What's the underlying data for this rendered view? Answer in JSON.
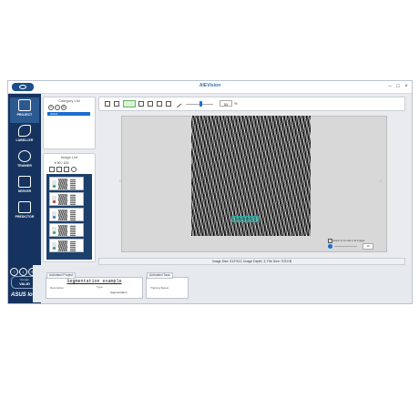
{
  "titlebar": {
    "title": "AIEVision",
    "minimize": "–",
    "maximize": "□",
    "close": "×"
  },
  "sidebar": {
    "items": [
      {
        "label": "PROJECT",
        "icon": "project-icon"
      },
      {
        "label": "LABELLER",
        "icon": "labeller-icon"
      },
      {
        "label": "TRAINER",
        "icon": "trainer-icon"
      },
      {
        "label": "SERVER",
        "icon": "server-icon"
      },
      {
        "label": "PREDICTOR",
        "icon": "predictor-icon"
      }
    ],
    "help_buttons": [
      "?",
      "i",
      "⟲"
    ],
    "license_caption": "Dongle",
    "license_status": "VALID",
    "brand": "ASUS IoT"
  },
  "category_list": {
    "title": "Category List",
    "items": [
      "class1"
    ]
  },
  "image_list": {
    "title": "Image List",
    "count_label": "50",
    "separator": "/",
    "total_label": "100"
  },
  "toolbar": {
    "zoom_value": "50",
    "percent": "%"
  },
  "canvas": {
    "overlay_label": "Segmentation",
    "right_controls": {
      "option_label": "Export to an xlab in all images",
      "value": "10"
    }
  },
  "status_bar": {
    "text": "Image Size: 512*512, Image Depth: 3, File Size: 703 KB"
  },
  "activated_project": {
    "tab": "Activated Project",
    "name": "Segmentation example",
    "description_label": "Description",
    "type_label": "Type",
    "type_value": "Segmentation"
  },
  "activated_task": {
    "tab": "Activated Task",
    "training_status_label": "Training Status"
  }
}
